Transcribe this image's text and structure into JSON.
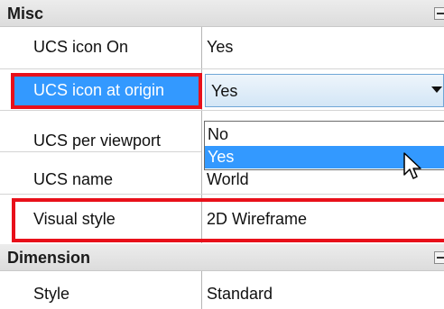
{
  "sections": {
    "misc": "Misc",
    "dimension": "Dimension"
  },
  "rows": {
    "ucs_icon_on": {
      "name": "UCS icon On",
      "value": "Yes"
    },
    "ucs_icon_at_origin": {
      "name": "UCS icon at origin",
      "value": "Yes"
    },
    "ucs_per_viewport": {
      "name": "UCS per viewport"
    },
    "ucs_name": {
      "name": "UCS name",
      "value": "World"
    },
    "visual_style": {
      "name": "Visual style",
      "value": "2D Wireframe"
    },
    "style": {
      "name": "Style",
      "value": "Standard"
    }
  },
  "dropdown": {
    "options": [
      "No",
      "Yes"
    ],
    "selected": "Yes"
  },
  "colors": {
    "selection": "#3399ff",
    "highlight_border": "#e8101a"
  },
  "icons": {
    "collapse": "minus-box-icon",
    "dropdown_arrow": "triangle-down-icon",
    "cursor": "mouse-pointer-icon"
  }
}
